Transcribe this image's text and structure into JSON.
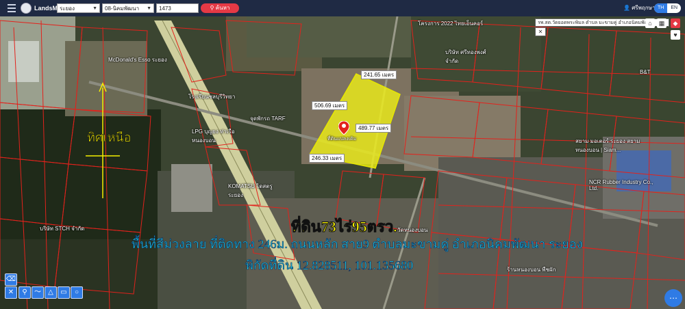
{
  "app": {
    "name": "LandsMaps"
  },
  "toolbar": {
    "province": "ระยอง",
    "district": "08-นิคมพัฒนา",
    "parcel_number": "1473",
    "search_label": "ค้นหา",
    "user_name": "ศรีพฤกษา",
    "lang_th": "TH",
    "lang_en": "EN"
  },
  "place_tag": {
    "text": "รพ.สต.วัดยอดพระพิมล ตำบล มะขามคู่ อำเภอนิคมพัฒนา",
    "close": "✕"
  },
  "measurements": {
    "top": "241.65 เมตร",
    "left": "506.69 เมตร",
    "right": "489.77 เมตร",
    "bottom": "246.33 เมตร"
  },
  "parcel_label": "ที่ดินแปลงเดิม",
  "overlay": {
    "title": "ที่ดิน73ไร่95ตรว.",
    "line2": "พื้นที่สีม่วงลาย ที่ติดทาง 246ม. ถนนหลัก สาย9 ตำบลมะขามคู่ อำเภอนิคมพัฒนา ระยอง",
    "line3": "พิกัดที่ดิน 12.828511, 101.135680",
    "north": "ทิศเหนือ"
  },
  "map_labels": {
    "mcdonalds": "McDonald's Esso ระยอง",
    "tarf": "จุดพักรถ TARF",
    "lpg": "LPG บุญยง ท่าเรือ หนองบอน",
    "komatsu": "KOMATSU ไดสตรู ระยอง",
    "stch": "บริษัท STCH จำกัด",
    "ncr": "NCR Rubber Industry Co., Ltd.",
    "siam": "สยาม มอเตอร์ ระยอง สยาม หนองบอน | Siam...",
    "bt": "B&T",
    "school": "โรงเรียนชลบุรีวิทยา",
    "watnongbon": "วัดหนองบอน",
    "ranhongbon": "ร้านหนองบอน พืชผัก",
    "twenty22": "โครงการ 2022 ไทยเอ็นคอร์",
    "poltec": "บริษัท ศรีทองพงศ์ จำกัด"
  },
  "colors": {
    "accent": "#2f7be5",
    "search": "#e53945",
    "topbar": "#1f2a44",
    "parcel": "#f2f214",
    "boundary": "#e3221c"
  }
}
